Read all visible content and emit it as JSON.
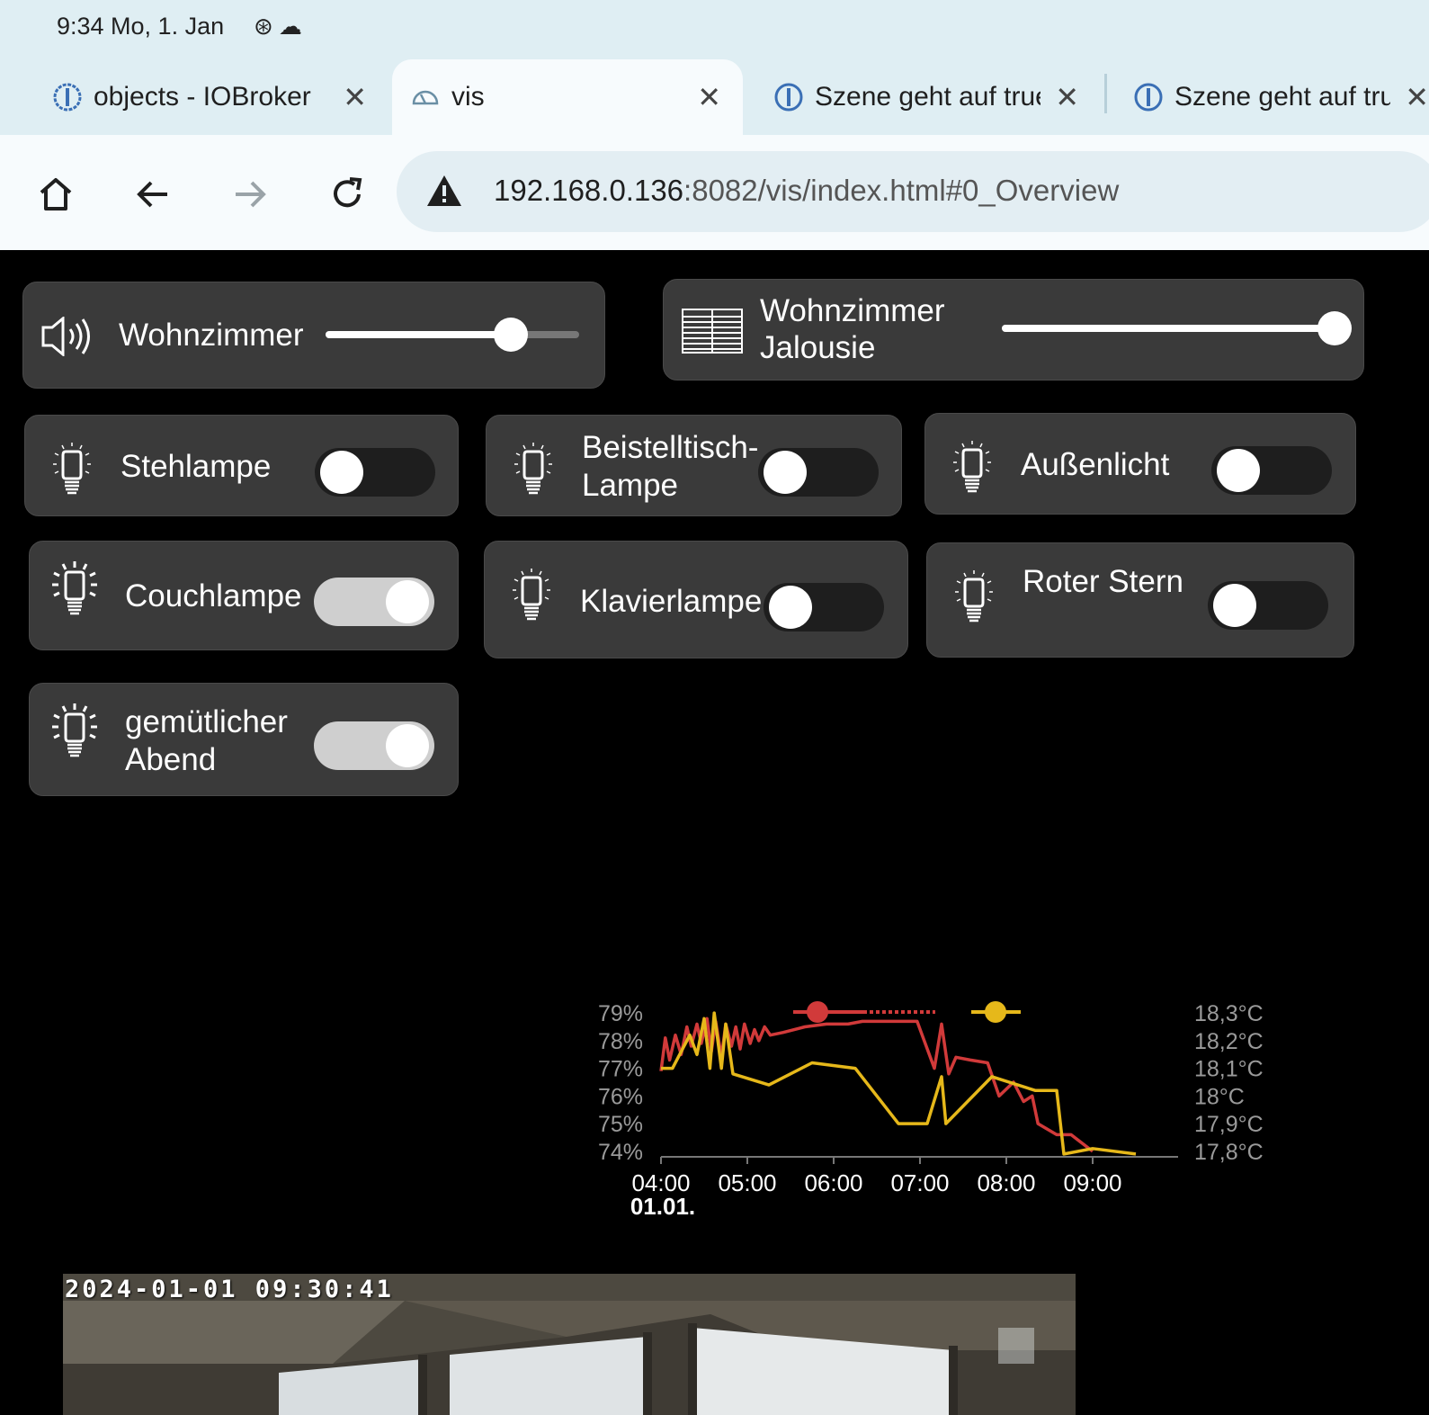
{
  "status_bar": {
    "time": "9:34 Mo, 1. Jan"
  },
  "tabs": [
    {
      "title": "objects - IOBroker"
    },
    {
      "title": "vis"
    },
    {
      "title": "Szene geht auf true"
    },
    {
      "title": "Szene geht auf true"
    }
  ],
  "address_bar": {
    "host": "192.168.0.136",
    "rest": ":8082/vis/index.html#0_Overview"
  },
  "widgets": {
    "volume": {
      "label": "Wohnzimmer",
      "value": 0.73
    },
    "blind": {
      "label_line1": "Wohnzimmer",
      "label_line2": "Jalousie",
      "value": 1.0
    },
    "lamps": [
      {
        "label": "Stehlampe",
        "on": false
      },
      {
        "label": "Beistelltisch-Lampe",
        "on": false
      },
      {
        "label": "Außenlicht",
        "on": false
      },
      {
        "label": "Couchlampe",
        "on": true
      },
      {
        "label": "Klavierlampe",
        "on": false
      },
      {
        "label": "Roter Stern",
        "on": false
      },
      {
        "label": "gemütlicher Abend",
        "on": true
      }
    ]
  },
  "chart_data": {
    "type": "line",
    "x_ticks": [
      "04:00",
      "05:00",
      "06:00",
      "07:00",
      "08:00",
      "09:00"
    ],
    "x_date_label": "01.01.",
    "y_left_ticks": [
      "79%",
      "78%",
      "77%",
      "76%",
      "75%",
      "74%"
    ],
    "y_right_ticks": [
      "18,3°C",
      "18,2°C",
      "18,1°C",
      "18°C",
      "17,9°C",
      "17,8°C"
    ],
    "xlim": [
      "04:00",
      "09:40"
    ],
    "ylim_left": [
      73.8,
      79.2
    ],
    "ylim_right": [
      17.78,
      18.32
    ],
    "series": [
      {
        "axis": "left",
        "unit": "%",
        "color": "#d13a3a",
        "points": [
          [
            "04:00",
            76.9
          ],
          [
            "04:03",
            78.1
          ],
          [
            "04:06",
            77.3
          ],
          [
            "04:10",
            78.2
          ],
          [
            "04:14",
            77.5
          ],
          [
            "04:18",
            78.5
          ],
          [
            "04:21",
            77.8
          ],
          [
            "04:25",
            78.6
          ],
          [
            "04:28",
            77.9
          ],
          [
            "04:32",
            78.8
          ],
          [
            "04:35",
            77.6
          ],
          [
            "04:38",
            78.7
          ],
          [
            "04:42",
            77.4
          ],
          [
            "04:45",
            78.6
          ],
          [
            "04:49",
            77.8
          ],
          [
            "04:52",
            78.5
          ],
          [
            "04:55",
            77.7
          ],
          [
            "04:58",
            78.6
          ],
          [
            "05:02",
            77.9
          ],
          [
            "05:05",
            78.4
          ],
          [
            "05:08",
            78.0
          ],
          [
            "05:12",
            78.5
          ],
          [
            "05:16",
            78.2
          ],
          [
            "05:25",
            78.3
          ],
          [
            "05:40",
            78.5
          ],
          [
            "05:55",
            78.6
          ],
          [
            "06:10",
            78.6
          ],
          [
            "06:20",
            78.7
          ],
          [
            "06:40",
            78.7
          ],
          [
            "06:58",
            78.7
          ],
          [
            "07:10",
            77.0
          ],
          [
            "07:15",
            78.6
          ],
          [
            "07:20",
            76.8
          ],
          [
            "07:25",
            77.4
          ],
          [
            "07:35",
            77.3
          ],
          [
            "07:47",
            77.2
          ],
          [
            "07:55",
            76.0
          ],
          [
            "08:05",
            76.5
          ],
          [
            "08:12",
            75.8
          ],
          [
            "08:18",
            76.0
          ],
          [
            "08:22",
            75.0
          ],
          [
            "08:35",
            74.6
          ],
          [
            "08:45",
            74.6
          ],
          [
            "09:00",
            74.0
          ]
        ]
      },
      {
        "axis": "right",
        "unit": "°C",
        "color": "#e6b81a",
        "points": [
          [
            "04:00",
            18.1
          ],
          [
            "04:08",
            18.1
          ],
          [
            "04:20",
            18.22
          ],
          [
            "04:25",
            18.15
          ],
          [
            "04:30",
            18.28
          ],
          [
            "04:34",
            18.1
          ],
          [
            "04:37",
            18.3
          ],
          [
            "04:42",
            18.1
          ],
          [
            "04:45",
            18.26
          ],
          [
            "04:50",
            18.08
          ],
          [
            "05:15",
            18.04
          ],
          [
            "05:45",
            18.12
          ],
          [
            "06:15",
            18.1
          ],
          [
            "06:45",
            17.9
          ],
          [
            "07:05",
            17.9
          ],
          [
            "07:15",
            18.07
          ],
          [
            "07:18",
            17.9
          ],
          [
            "07:50",
            18.07
          ],
          [
            "08:20",
            18.02
          ],
          [
            "08:35",
            18.02
          ],
          [
            "08:40",
            17.79
          ],
          [
            "09:00",
            17.81
          ],
          [
            "09:30",
            17.79
          ]
        ]
      }
    ]
  },
  "camera": {
    "timestamp": "2024-01-01 09:30:41"
  }
}
